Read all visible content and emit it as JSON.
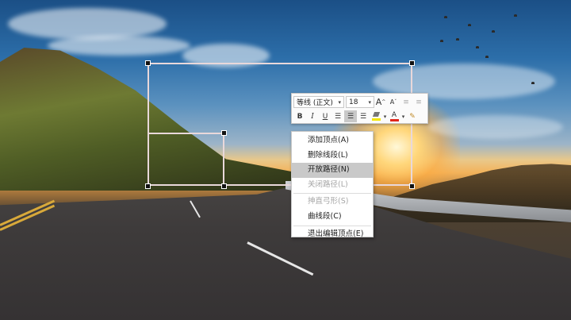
{
  "toolbar": {
    "font_name": "等线 (正文)",
    "font_size": "18",
    "grow_font_icon": "A",
    "shrink_font_icon": "A",
    "bold": "B",
    "italic": "I",
    "underline": "U",
    "font_color_letter": "A",
    "highlight_color": "#f2e600",
    "font_color": "#e0251b"
  },
  "context_menu": {
    "items": [
      {
        "label": "添加顶点(A)",
        "state": "normal"
      },
      {
        "label": "删除线段(L)",
        "state": "normal"
      },
      {
        "label": "开放路径(N)",
        "state": "highlighted"
      },
      {
        "label": "关闭路径(L)",
        "state": "disabled"
      },
      {
        "label": "抻直弓形(S)",
        "state": "disabled"
      },
      {
        "label": "曲线段(C)",
        "state": "normal"
      },
      {
        "label": "退出编辑顶点(E)",
        "state": "normal"
      }
    ]
  }
}
